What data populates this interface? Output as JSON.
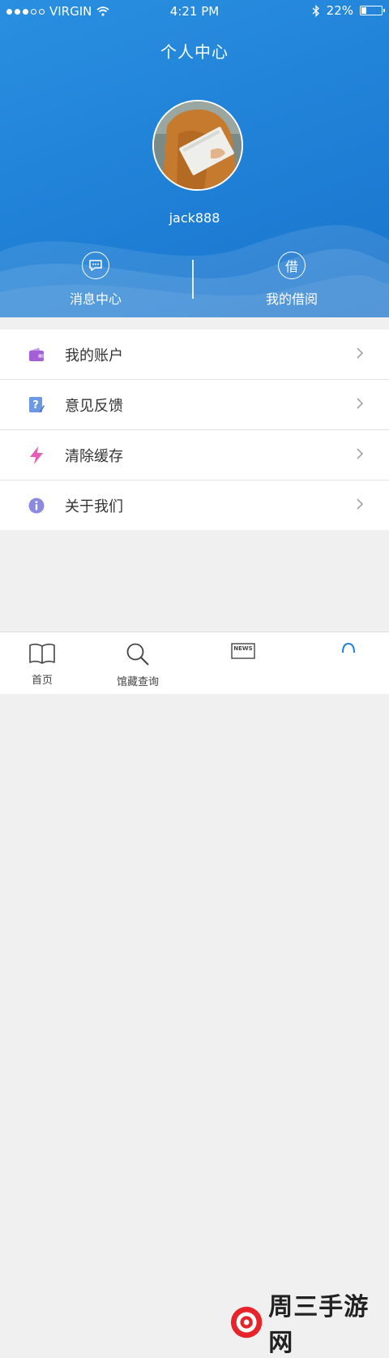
{
  "status_bar": {
    "carrier": "VIRGIN",
    "time": "4:21 PM",
    "battery": "22%",
    "battery_level": 0.22
  },
  "header": {
    "title": "个人中心",
    "username": "jack888"
  },
  "quick_actions": [
    {
      "label": "消息中心",
      "icon": "message-icon"
    },
    {
      "label": "我的借阅",
      "icon": "borrow-icon",
      "glyph": "借"
    }
  ],
  "menu": [
    {
      "label": "我的账户",
      "icon": "wallet-icon",
      "color": "#a35fd6"
    },
    {
      "label": "意见反馈",
      "icon": "feedback-icon",
      "color": "#6d98e6"
    },
    {
      "label": "清除缓存",
      "icon": "lightning-icon",
      "color": "#e65db5"
    },
    {
      "label": "关于我们",
      "icon": "info-icon",
      "color": "#8a8ae0"
    }
  ],
  "tabbar": [
    {
      "label": "首页",
      "icon": "book-icon"
    },
    {
      "label": "馆藏查询",
      "icon": "search-icon"
    },
    {
      "label": "",
      "icon": "news-icon",
      "icon_text": "NEWS"
    },
    {
      "label": "",
      "icon": "profile-icon"
    }
  ],
  "watermark": {
    "text": "周三手游网"
  }
}
